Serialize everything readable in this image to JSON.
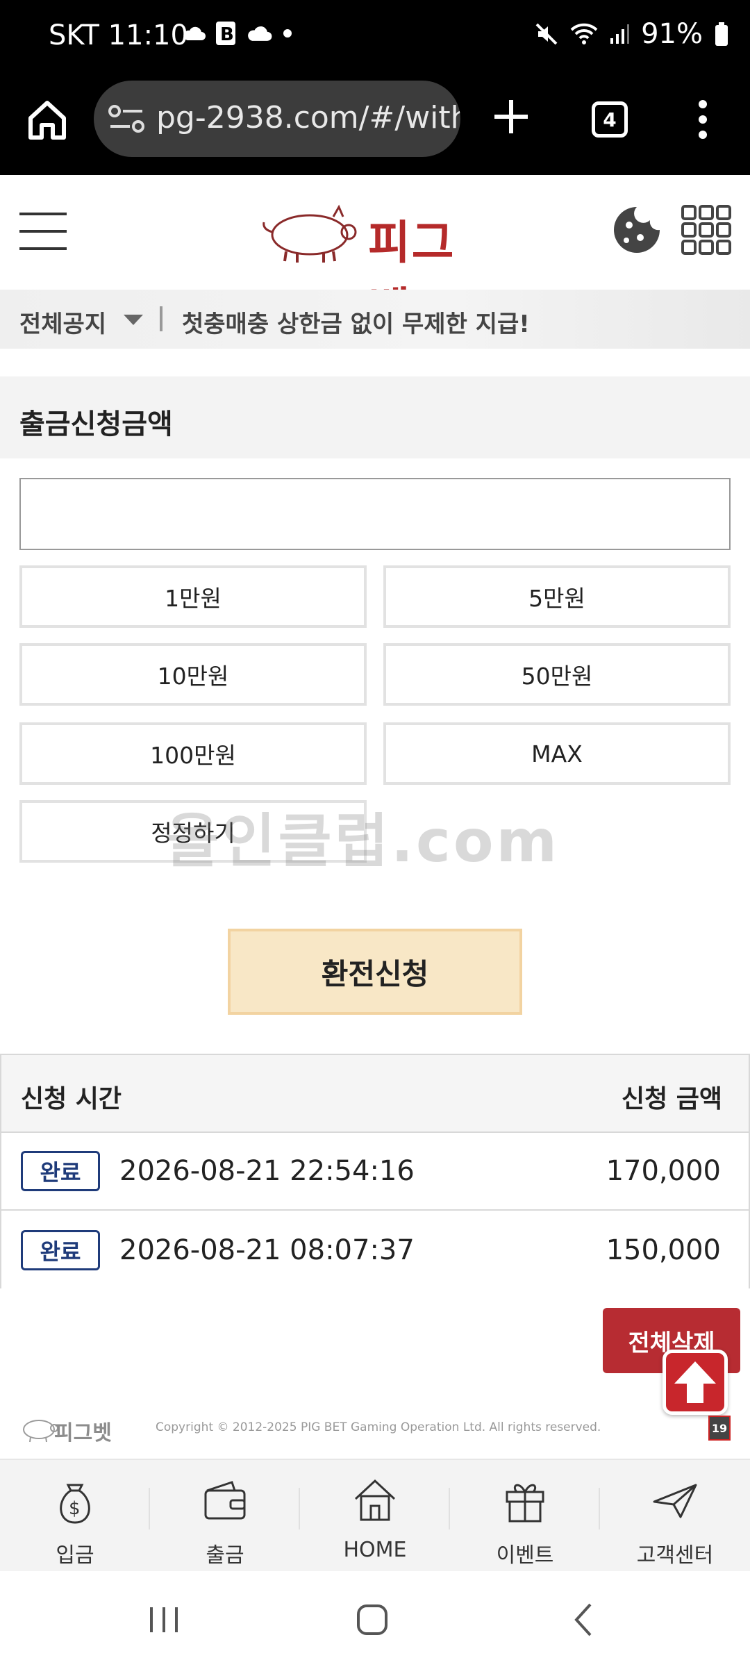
{
  "status_bar": {
    "time": "SKT 11:10",
    "battery": "91%"
  },
  "browser": {
    "url": "pg-2938.com/#/with",
    "tab_count": "4"
  },
  "header": {
    "logo_text": "피그벳"
  },
  "notice": {
    "category": "전체공지",
    "text": "첫충매충 상한금 없이 무제한 지급!"
  },
  "withdraw": {
    "title": "출금신청금액",
    "amount_value": "",
    "buttons": [
      "1만원",
      "5만원",
      "10만원",
      "50만원",
      "100만원",
      "MAX",
      "정정하기"
    ],
    "submit_label": "환전신청"
  },
  "watermark": "올인클럽.com",
  "history": {
    "col_time": "신청 시간",
    "col_amount": "신청 금액",
    "rows": [
      {
        "status": "완료",
        "time": "2026-08-21 22:54:16",
        "amount": "170,000"
      },
      {
        "status": "완료",
        "time": "2026-08-21 08:07:37",
        "amount": "150,000"
      }
    ]
  },
  "delete_all_label": "전체삭제",
  "footer": {
    "logo_text": "피그벳",
    "copyright": "Copyright © 2012-2025 PIG BET Gaming Operation Ltd. All rights reserved.",
    "age_label": "19"
  },
  "bottom_nav": [
    {
      "label": "입금",
      "icon": "money-bag-icon"
    },
    {
      "label": "출금",
      "icon": "wallet-icon"
    },
    {
      "label": "HOME",
      "icon": "house-icon"
    },
    {
      "label": "이벤트",
      "icon": "gift-icon"
    },
    {
      "label": "고객센터",
      "icon": "paper-plane-icon"
    }
  ],
  "colors": {
    "brand_red": "#b52a2a",
    "submit_bg": "#f8e7c6",
    "badge_blue": "#1f3b7a",
    "delete_red": "#b72c32"
  }
}
